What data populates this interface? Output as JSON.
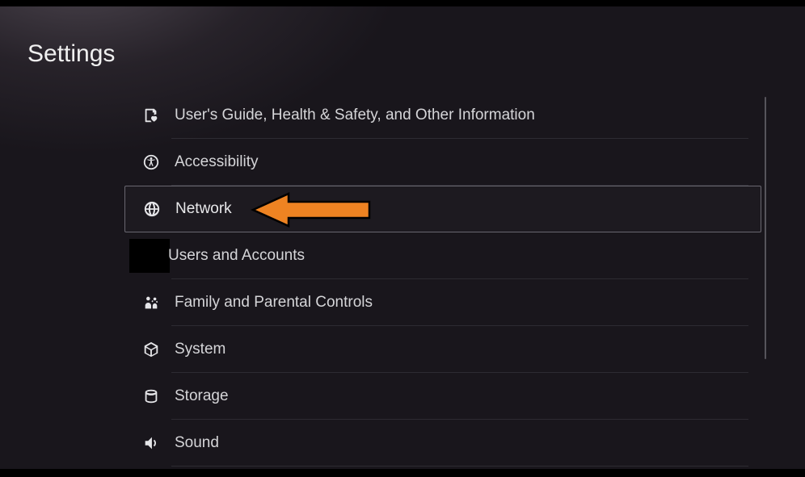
{
  "header": {
    "title": "Settings"
  },
  "menu_items": [
    {
      "label": "User's Guide, Health & Safety, and Other Information",
      "icon": "guide-heart-icon",
      "selected": false
    },
    {
      "label": "Accessibility",
      "icon": "accessibility-icon",
      "selected": false
    },
    {
      "label": "Network",
      "icon": "globe-icon",
      "selected": true
    },
    {
      "label": "Users and Accounts",
      "icon": "masked-icon",
      "selected": false
    },
    {
      "label": "Family and Parental Controls",
      "icon": "family-icon",
      "selected": false
    },
    {
      "label": "System",
      "icon": "cube-icon",
      "selected": false
    },
    {
      "label": "Storage",
      "icon": "storage-icon",
      "selected": false
    },
    {
      "label": "Sound",
      "icon": "speaker-icon",
      "selected": false
    }
  ],
  "annotation": {
    "color": "#ee8322",
    "points_to": "Network"
  }
}
